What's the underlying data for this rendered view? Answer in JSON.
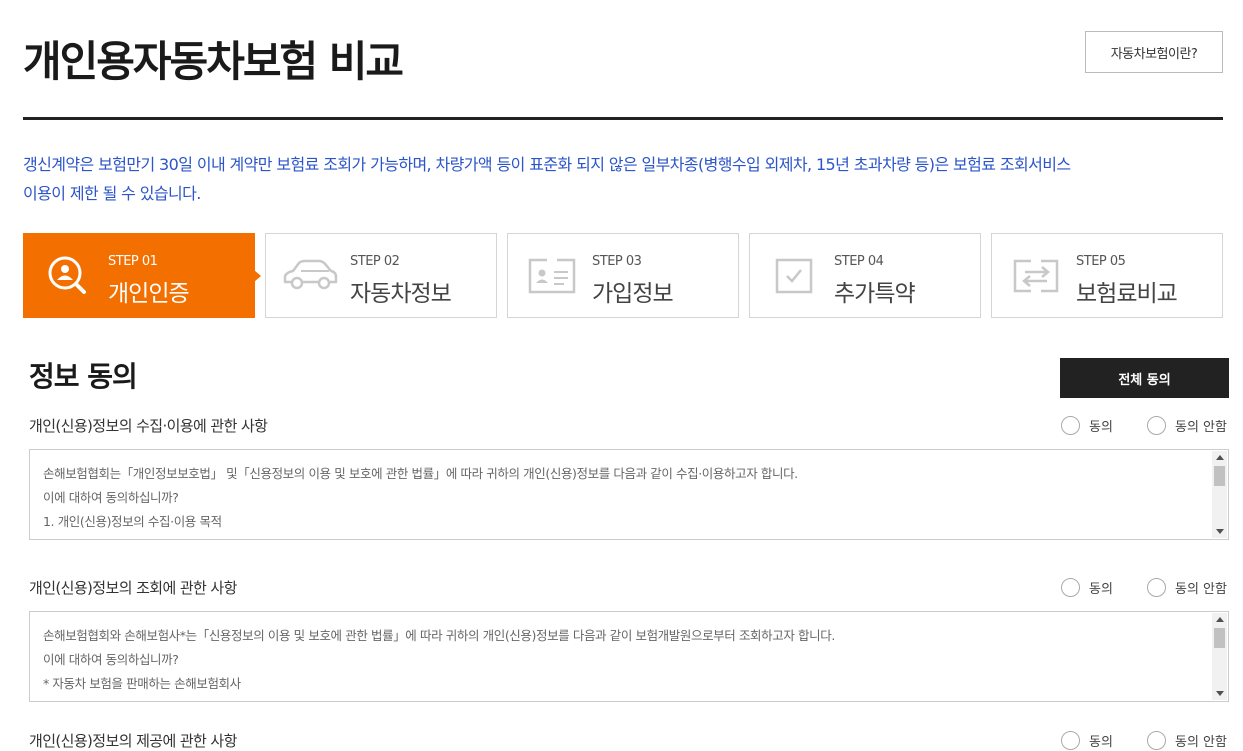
{
  "header": {
    "title": "개인용자동차보험 비교",
    "info_button": "자동차보험이란?"
  },
  "notice": {
    "line1": "갱신계약은 보험만기 30일 이내 계약만 보험료 조회가 가능하며, 차량가액 등이 표준화 되지 않은 일부차종(병행수입 외제차, 15년 초과차량 등)은 보험료 조회서비스",
    "line2": "이용이 제한 될 수 있습니다.",
    "color": "#2b55c9"
  },
  "steps": [
    {
      "num": "STEP 01",
      "name": "개인인증",
      "icon": "search-person-icon",
      "active": true
    },
    {
      "num": "STEP 02",
      "name": "자동차정보",
      "icon": "car-icon",
      "active": false
    },
    {
      "num": "STEP 03",
      "name": "가입정보",
      "icon": "id-card-icon",
      "active": false
    },
    {
      "num": "STEP 04",
      "name": "추가특약",
      "icon": "checkbox-icon",
      "active": false
    },
    {
      "num": "STEP 05",
      "name": "보험료비교",
      "icon": "exchange-icon",
      "active": false
    }
  ],
  "accent_color": "#f26f00",
  "consent": {
    "title": "정보 동의",
    "agree_all": "전체 동의",
    "agree_label": "동의",
    "disagree_label": "동의 안함",
    "terms": [
      {
        "title": "개인(신용)정보의 수집·이용에 관한 사항",
        "lines": [
          "손해보험협회는「개인정보보호법」 및「신용정보의 이용 및 보호에 관한 법률」에 따라 귀하의 개인(신용)정보를 다음과 같이 수집·이용하고자 합니다.",
          "이에 대하여 동의하십니까?",
          "1. 개인(신용)정보의 수집·이용 목적"
        ]
      },
      {
        "title": "개인(신용)정보의 조회에 관한 사항",
        "lines": [
          "손해보험협회와 손해보험사*는「신용정보의 이용 및 보호에 관한 법률」에 따라 귀하의 개인(신용)정보를 다음과 같이 보험개발원으로부터 조회하고자 합니다.",
          "이에 대하여 동의하십니까?",
          "* 자동차 보험을 판매하는 손해보험회사"
        ]
      },
      {
        "title": "개인(신용)정보의 제공에 관한 사항",
        "lines": []
      }
    ]
  }
}
